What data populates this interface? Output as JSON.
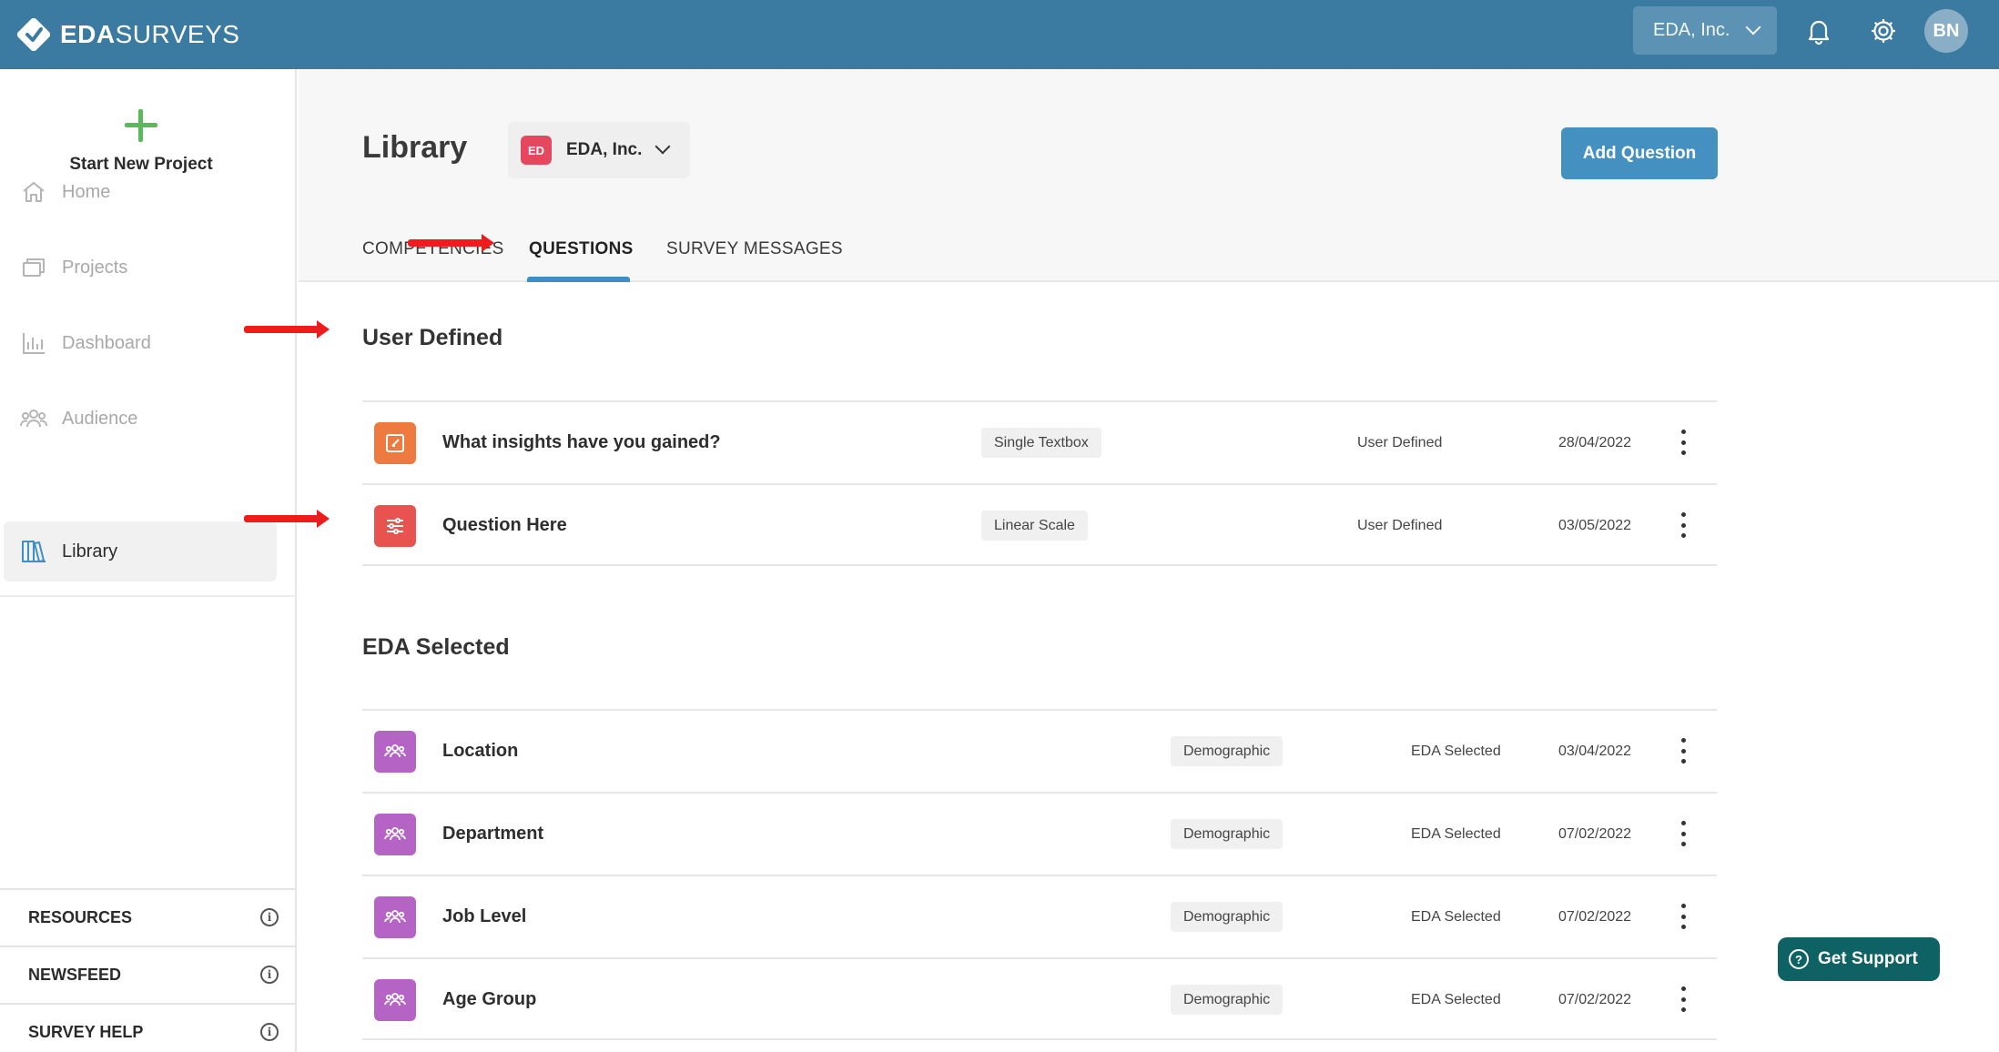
{
  "app": {
    "logo_bold": "EDA",
    "logo_light": "SURVEYS"
  },
  "topbar": {
    "org_selector": "EDA, Inc.",
    "user_initials": "BN"
  },
  "sidebar": {
    "new_project": "Start New Project",
    "items": [
      {
        "label": "Home",
        "icon": "home-icon"
      },
      {
        "label": "Projects",
        "icon": "folders-icon"
      },
      {
        "label": "Dashboard",
        "icon": "bar-chart-icon"
      },
      {
        "label": "Audience",
        "icon": "people-icon"
      },
      {
        "label": "Library",
        "icon": "books-icon",
        "active": true
      }
    ],
    "footer": [
      "RESOURCES",
      "NEWSFEED",
      "SURVEY HELP"
    ]
  },
  "header": {
    "title": "Library",
    "org_badge": "ED",
    "org_name": "EDA, Inc.",
    "add_button": "Add Question",
    "tabs": [
      "COMPETENCIES",
      "QUESTIONS",
      "SURVEY MESSAGES"
    ],
    "active_tab": "QUESTIONS"
  },
  "sections": [
    {
      "title": "User Defined",
      "rows": [
        {
          "title": "What insights have you gained?",
          "type": "Single Textbox",
          "source": "User Defined",
          "date": "28/04/2022",
          "icon": "edit-icon",
          "color": "#ef7a3f"
        },
        {
          "title": "Question Here",
          "type": "Linear Scale",
          "source": "User Defined",
          "date": "03/05/2022",
          "icon": "sliders-icon",
          "color": "#e9534f"
        }
      ]
    },
    {
      "title": "EDA Selected",
      "rows": [
        {
          "title": "Location",
          "type": "Demographic",
          "source": "EDA Selected",
          "date": "03/04/2022",
          "icon": "people-icon",
          "color": "#b564c6"
        },
        {
          "title": "Department",
          "type": "Demographic",
          "source": "EDA Selected",
          "date": "07/02/2022",
          "icon": "people-icon",
          "color": "#b564c6"
        },
        {
          "title": "Job Level",
          "type": "Demographic",
          "source": "EDA Selected",
          "date": "07/02/2022",
          "icon": "people-icon",
          "color": "#b564c6"
        },
        {
          "title": "Age Group",
          "type": "Demographic",
          "source": "EDA Selected",
          "date": "07/02/2022",
          "icon": "people-icon",
          "color": "#b564c6"
        }
      ]
    }
  ],
  "support": {
    "label": "Get Support"
  },
  "colors": {
    "topbar": "#3b7ba1",
    "accent": "#4390c1",
    "annotation_arrow": "#ee1c1c",
    "support": "#0f6264"
  }
}
